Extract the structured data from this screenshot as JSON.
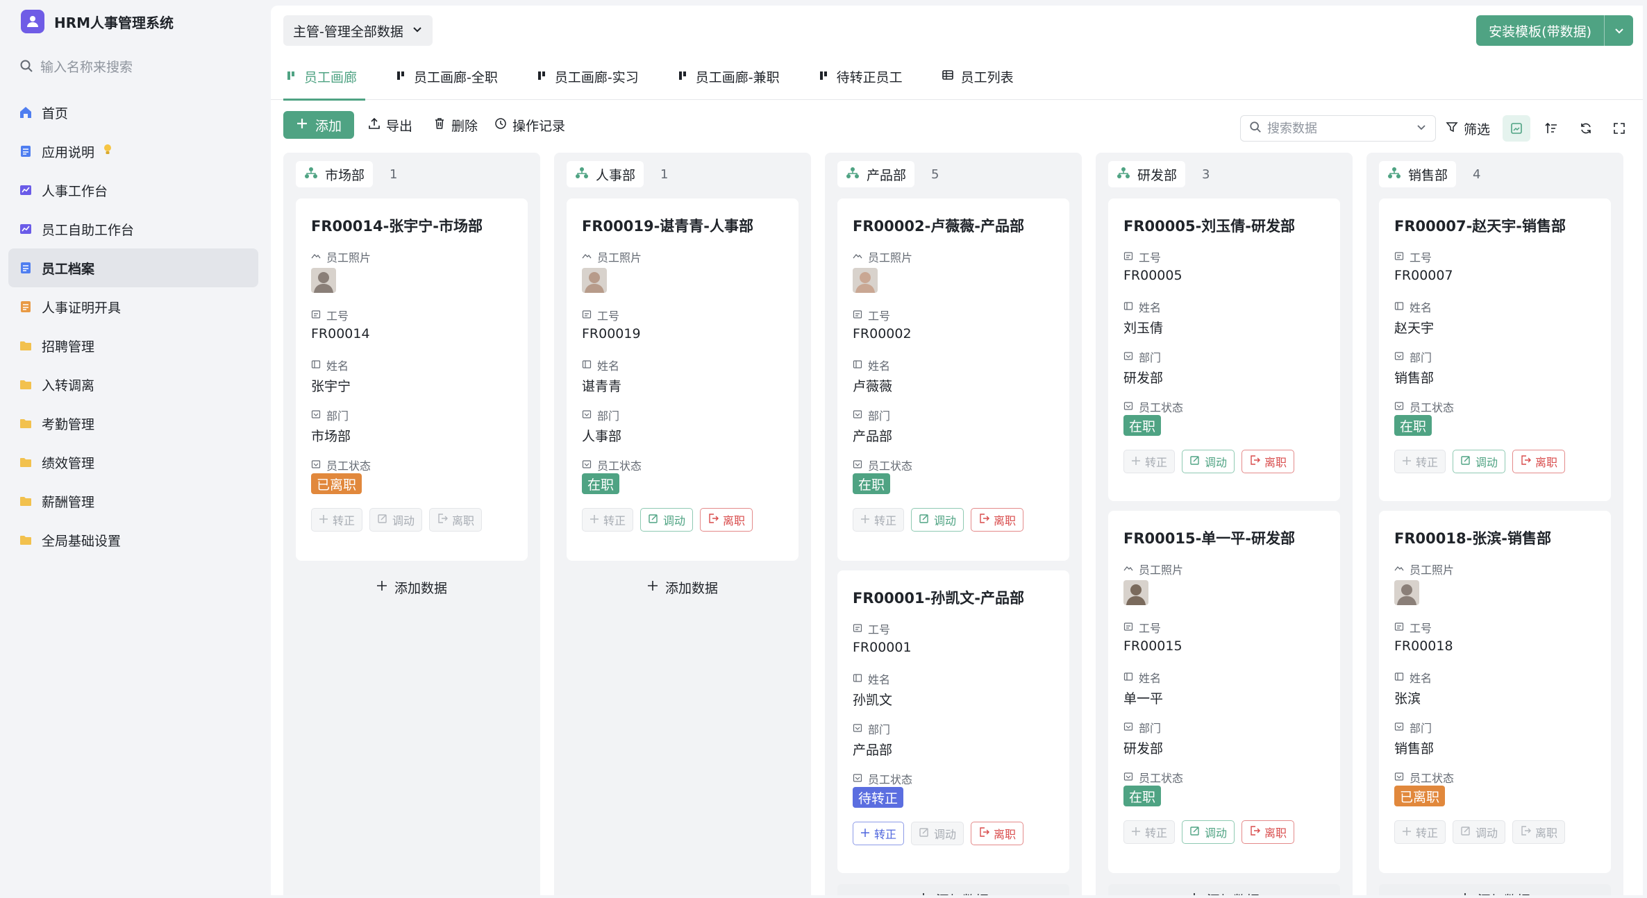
{
  "app": {
    "title": "HRM人事管理系统",
    "accent": "#4fa383"
  },
  "sidebar": {
    "search_placeholder": "输入名称来搜索",
    "items": [
      {
        "label": "首页",
        "icon": "home-icon",
        "active": false
      },
      {
        "label": "应用说明",
        "icon": "doc-icon",
        "active": false
      },
      {
        "label": "人事工作台",
        "icon": "chart-icon",
        "active": false
      },
      {
        "label": "员工自助工作台",
        "icon": "chart-icon",
        "active": false
      },
      {
        "label": "员工档案",
        "icon": "doc-icon",
        "active": true
      },
      {
        "label": "人事证明开具",
        "icon": "doc-icon",
        "active": false
      },
      {
        "label": "招聘管理",
        "icon": "folder-icon",
        "active": false
      },
      {
        "label": "入转调离",
        "icon": "folder-icon",
        "active": false
      },
      {
        "label": "考勤管理",
        "icon": "folder-icon",
        "active": false
      },
      {
        "label": "绩效管理",
        "icon": "folder-icon",
        "active": false
      },
      {
        "label": "薪酬管理",
        "icon": "folder-icon",
        "active": false
      },
      {
        "label": "全局基础设置",
        "icon": "folder-icon",
        "active": false
      }
    ]
  },
  "topbar": {
    "scope": "主管-管理全部数据",
    "install_label": "安装模板(带数据)"
  },
  "tabs": [
    {
      "label": "员工画廊",
      "icon": "kanban-icon",
      "active": true
    },
    {
      "label": "员工画廊-全职",
      "icon": "kanban-icon",
      "active": false
    },
    {
      "label": "员工画廊-实习",
      "icon": "kanban-icon",
      "active": false
    },
    {
      "label": "员工画廊-兼职",
      "icon": "kanban-icon",
      "active": false
    },
    {
      "label": "待转正员工",
      "icon": "kanban-icon",
      "active": false
    },
    {
      "label": "员工列表",
      "icon": "table-icon",
      "active": false
    }
  ],
  "toolbar": {
    "add": "添加",
    "export": "导出",
    "delete": "删除",
    "log": "操作记录",
    "search_placeholder": "搜索数据",
    "filter": "筛选"
  },
  "labels": {
    "photo": "员工照片",
    "id": "工号",
    "name": "姓名",
    "dept": "部门",
    "status": "员工状态",
    "promote": "转正",
    "transfer": "调动",
    "leave": "离职",
    "add_data": "添加数据"
  },
  "columns": [
    {
      "name": "市场部",
      "count": "1",
      "cards": [
        {
          "title": "FR00014-张宇宁-市场部",
          "has_photo": true,
          "id": "FR00014",
          "name": "张宇宁",
          "dept": "市场部",
          "status": "已离职",
          "status_color": "orange",
          "promote": "disabled",
          "transfer": "disabled",
          "leave": "disabled"
        }
      ]
    },
    {
      "name": "人事部",
      "count": "1",
      "cards": [
        {
          "title": "FR00019-谌青青-人事部",
          "has_photo": true,
          "id": "FR00019",
          "name": "谌青青",
          "dept": "人事部",
          "status": "在职",
          "status_color": "green",
          "promote": "disabled",
          "transfer": "green",
          "leave": "red"
        }
      ]
    },
    {
      "name": "产品部",
      "count": "5",
      "cards": [
        {
          "title": "FR00002-卢薇薇-产品部",
          "has_photo": true,
          "id": "FR00002",
          "name": "卢薇薇",
          "dept": "产品部",
          "status": "在职",
          "status_color": "green",
          "promote": "disabled",
          "transfer": "green",
          "leave": "red"
        },
        {
          "title": "FR00001-孙凯文-产品部",
          "has_photo": false,
          "id": "FR00001",
          "name": "孙凯文",
          "dept": "产品部",
          "status": "待转正",
          "status_color": "blue",
          "promote": "blue",
          "transfer": "disabled",
          "leave": "red"
        }
      ]
    },
    {
      "name": "研发部",
      "count": "3",
      "cards": [
        {
          "title": "FR00005-刘玉倩-研发部",
          "has_photo": false,
          "id": "FR00005",
          "name": "刘玉倩",
          "dept": "研发部",
          "status": "在职",
          "status_color": "green",
          "promote": "disabled",
          "transfer": "green",
          "leave": "red"
        },
        {
          "title": "FR00015-单一平-研发部",
          "has_photo": true,
          "id": "FR00015",
          "name": "单一平",
          "dept": "研发部",
          "status": "在职",
          "status_color": "green",
          "promote": "disabled",
          "transfer": "green",
          "leave": "red"
        }
      ]
    },
    {
      "name": "销售部",
      "count": "4",
      "cards": [
        {
          "title": "FR00007-赵天宇-销售部",
          "has_photo": false,
          "id": "FR00007",
          "name": "赵天宇",
          "dept": "销售部",
          "status": "在职",
          "status_color": "green",
          "promote": "disabled",
          "transfer": "green",
          "leave": "red"
        },
        {
          "title": "FR00018-张滨-销售部",
          "has_photo": true,
          "id": "FR00018",
          "name": "张滨",
          "dept": "销售部",
          "status": "已离职",
          "status_color": "orange",
          "promote": "disabled",
          "transfer": "disabled",
          "leave": "disabled"
        }
      ]
    }
  ]
}
